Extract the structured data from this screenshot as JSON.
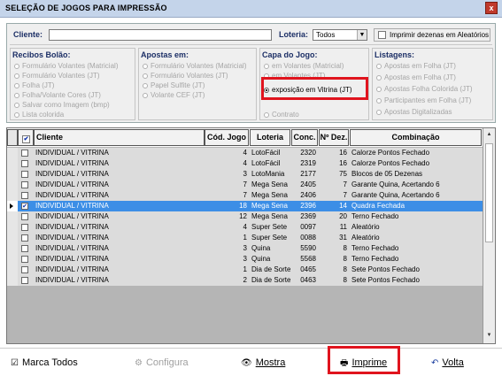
{
  "window": {
    "title": "SELEÇÃO DE JOGOS PARA IMPRESSÃO",
    "close_label": "x"
  },
  "filters": {
    "cliente_label": "Cliente:",
    "cliente_value": "",
    "loteria_label": "Loteria:",
    "loteria_value": "Todos",
    "aleatorios_label": "Imprimir dezenas em Aleatórios",
    "aleatorios_checked": false
  },
  "groups": {
    "recibos": {
      "title": "Recibos Bolão:",
      "options": [
        "Formulário Volantes (Matricial)",
        "Formulário Volantes (JT)",
        "Folha (JT)",
        "Folha/Volante Cores (JT)",
        "Salvar como Imagem (bmp)",
        "Lista colorida"
      ]
    },
    "apostas": {
      "title": "Apostas em:",
      "options": [
        "Formulário Volantes (Matricial)",
        "Formulário Volantes (JT)",
        "Papel Sulfite (JT)",
        "Volante CEF (JT)"
      ]
    },
    "capa": {
      "title": "Capa do Jogo:",
      "options": [
        "em Volantes (Matricial)",
        "em Volantes (JT)",
        "exposição em Vitrina (JT)",
        "Contrato"
      ],
      "selected": "exposição em Vitrina (JT)"
    },
    "listagens": {
      "title": "Listagens:",
      "options": [
        "Apostas em Folha (JT)",
        "Apostas em Folha (JT)",
        "Apostas Folha Colorida (JT)",
        "Participantes em Folha (JT)",
        "Apostas Digitalizadas"
      ]
    }
  },
  "table": {
    "columns": [
      "",
      "Cliente",
      "Cód. Jogo",
      "Loteria",
      "Conc.",
      "Nº Dez.",
      "Combinação"
    ],
    "rows": [
      {
        "checked": false,
        "cliente": "INDIVIDUAL / VITRINA",
        "cod": "4",
        "loteria": "LotoFácil",
        "conc": "2320",
        "dez": "16",
        "comb": "Calorze Pontos Fechado"
      },
      {
        "checked": false,
        "cliente": "INDIVIDUAL / VITRINA",
        "cod": "4",
        "loteria": "LotoFácil",
        "conc": "2319",
        "dez": "16",
        "comb": "Calorze Pontos Fechado"
      },
      {
        "checked": false,
        "cliente": "INDIVIDUAL / VITRINA",
        "cod": "3",
        "loteria": "LotoMania",
        "conc": "2177",
        "dez": "75",
        "comb": "Blocos de 05 Dezenas"
      },
      {
        "checked": false,
        "cliente": "INDIVIDUAL / VITRINA",
        "cod": "7",
        "loteria": "Mega Sena",
        "conc": "2405",
        "dez": "7",
        "comb": "Garante Quina, Acertando 6"
      },
      {
        "checked": false,
        "cliente": "INDIVIDUAL / VITRINA",
        "cod": "7",
        "loteria": "Mega Sena",
        "conc": "2406",
        "dez": "7",
        "comb": "Garante Quina, Acertando 6"
      },
      {
        "checked": true,
        "cliente": "INDIVIDUAL / VITRINA",
        "cod": "18",
        "loteria": "Mega Sena",
        "conc": "2396",
        "dez": "14",
        "comb": "Quadra Fechada",
        "selected": true
      },
      {
        "checked": false,
        "cliente": "INDIVIDUAL / VITRINA",
        "cod": "12",
        "loteria": "Mega Sena",
        "conc": "2369",
        "dez": "20",
        "comb": "Terno Fechado"
      },
      {
        "checked": false,
        "cliente": "INDIVIDUAL / VITRINA",
        "cod": "4",
        "loteria": "Super Sete",
        "conc": "0097",
        "dez": "11",
        "comb": "Aleatório"
      },
      {
        "checked": false,
        "cliente": "INDIVIDUAL / VITRINA",
        "cod": "1",
        "loteria": "Super Sete",
        "conc": "0088",
        "dez": "31",
        "comb": "Aleatório"
      },
      {
        "checked": false,
        "cliente": "INDIVIDUAL / VITRINA",
        "cod": "3",
        "loteria": "Quina",
        "conc": "5590",
        "dez": "8",
        "comb": "Terno Fechado"
      },
      {
        "checked": false,
        "cliente": "INDIVIDUAL / VITRINA",
        "cod": "3",
        "loteria": "Quina",
        "conc": "5568",
        "dez": "8",
        "comb": "Terno Fechado"
      },
      {
        "checked": false,
        "cliente": "INDIVIDUAL / VITRINA",
        "cod": "1",
        "loteria": "Dia de Sorte",
        "conc": "0465",
        "dez": "8",
        "comb": "Sete Pontos Fechado"
      },
      {
        "checked": false,
        "cliente": "INDIVIDUAL / VITRINA",
        "cod": "2",
        "loteria": "Dia de Sorte",
        "conc": "0463",
        "dez": "8",
        "comb": "Sete Pontos Fechado"
      }
    ]
  },
  "footer": {
    "marca_todos": "Marca Todos",
    "configura": "Configura",
    "mostra": "Mostra",
    "imprime": "Imprime",
    "volta": "Volta"
  },
  "colors": {
    "highlight_box": "#e0141e",
    "selected_row": "#3c8ee6"
  }
}
